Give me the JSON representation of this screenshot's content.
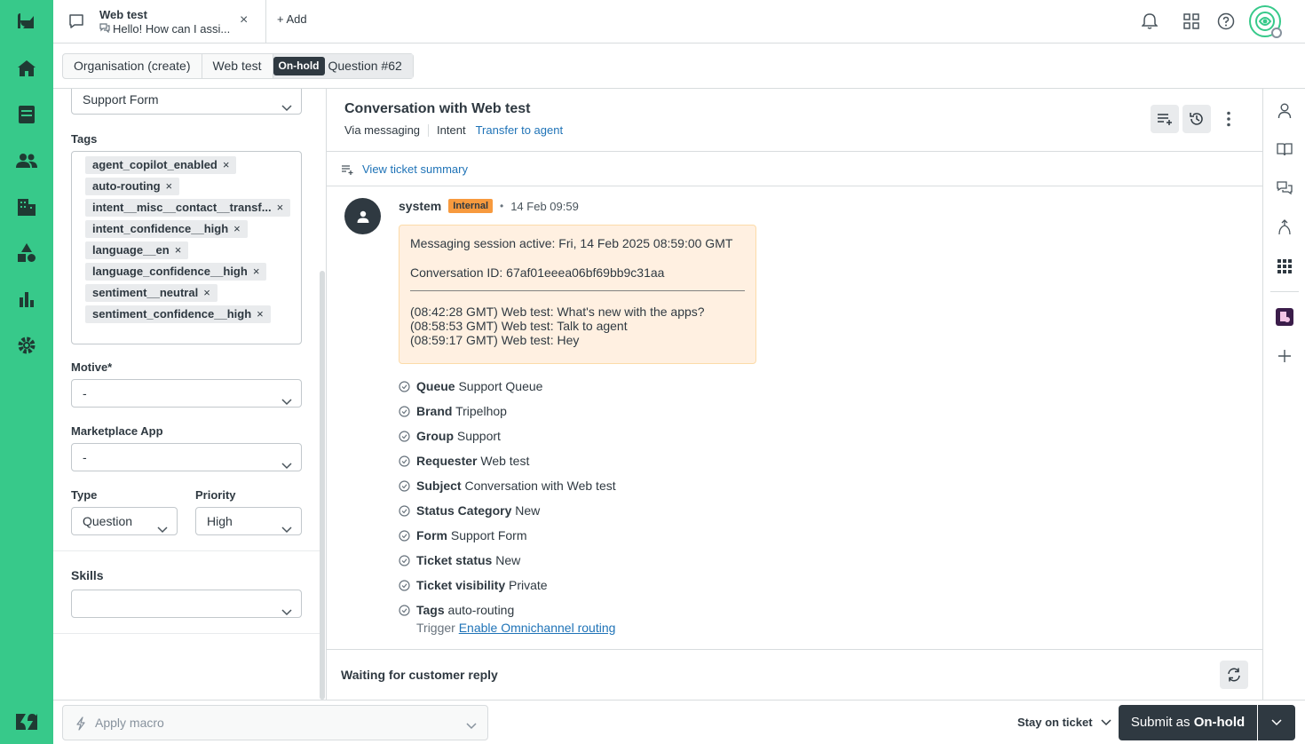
{
  "colors": {
    "brand_green": "#37c98a",
    "dark": "#2f3941",
    "link": "#1f73b7",
    "internal_badge": "#f79a3e",
    "note_bg": "#fff0e1"
  },
  "leftnav": {
    "icons": [
      "zendesk-logo-icon",
      "home-icon",
      "views-icon",
      "customers-icon",
      "organizations-icon",
      "admin-shapes-icon",
      "reporting-icon",
      "settings-icon",
      "zendesk-products-icon"
    ]
  },
  "topbar": {
    "tab": {
      "title": "Web test",
      "subtitle": "Hello! How can I assi...",
      "close": "×"
    },
    "add_label": "Add",
    "add_plus": "+"
  },
  "breadcrumbs": {
    "items": [
      "Organisation (create)",
      "Web test"
    ],
    "status_badge": "On-hold",
    "ticket_label": "Question #62"
  },
  "properties": {
    "form_value": "Support Form",
    "tags_label": "Tags",
    "tags": [
      "agent_copilot_enabled",
      "auto-routing",
      "intent__misc__contact__transf...",
      "intent_confidence__high",
      "language__en",
      "language_confidence__high",
      "sentiment__neutral",
      "sentiment_confidence__high"
    ],
    "tag_remove": "×",
    "motive_label": "Motive*",
    "motive_value": "-",
    "marketplace_label": "Marketplace App",
    "marketplace_value": "-",
    "type_label": "Type",
    "type_value": "Question",
    "priority_label": "Priority",
    "priority_value": "High",
    "skills_label": "Skills",
    "skills_value": ""
  },
  "conversation": {
    "title": "Conversation with Web test",
    "via": "Via messaging",
    "intent_label": "Intent",
    "intent_value": "Transfer to agent",
    "summary_link": "View ticket summary",
    "message": {
      "author": "system",
      "badge": "Internal",
      "separator": "•",
      "time": "14 Feb 09:59",
      "note_lines": [
        "Messaging session active: Fri, 14 Feb 2025 08:59:00 GMT",
        "Conversation ID: 67af01eeea06bf69bb9c31aa"
      ],
      "transcript": [
        "(08:42:28 GMT) Web test: What's new with the apps?",
        "(08:58:53 GMT) Web test: Talk to agent",
        "(08:59:17 GMT) Web test: Hey"
      ]
    },
    "events": [
      {
        "key": "Queue",
        "value": "Support Queue"
      },
      {
        "key": "Brand",
        "value": "Tripelhop"
      },
      {
        "key": "Group",
        "value": "Support"
      },
      {
        "key": "Requester",
        "value": "Web test"
      },
      {
        "key": "Subject",
        "value": "Conversation with Web test"
      },
      {
        "key": "Status Category",
        "value": "New"
      },
      {
        "key": "Form",
        "value": "Support Form"
      },
      {
        "key": "Ticket status",
        "value": "New"
      },
      {
        "key": "Ticket visibility",
        "value": "Private"
      },
      {
        "key": "Tags",
        "value": "auto-routing"
      }
    ],
    "trigger_label": "Trigger",
    "trigger_link": "Enable Omnichannel routing",
    "waiting": "Waiting for customer reply"
  },
  "rail": {
    "icons": [
      "user-icon",
      "knowledge-icon",
      "conversations-icon",
      "merge-icon",
      "apps-icon",
      "app-integration-icon",
      "add-icon"
    ]
  },
  "bottombar": {
    "macro_placeholder": "Apply macro",
    "stay_label": "Stay on ticket",
    "submit_prefix": "Submit as",
    "submit_status": "On-hold"
  }
}
